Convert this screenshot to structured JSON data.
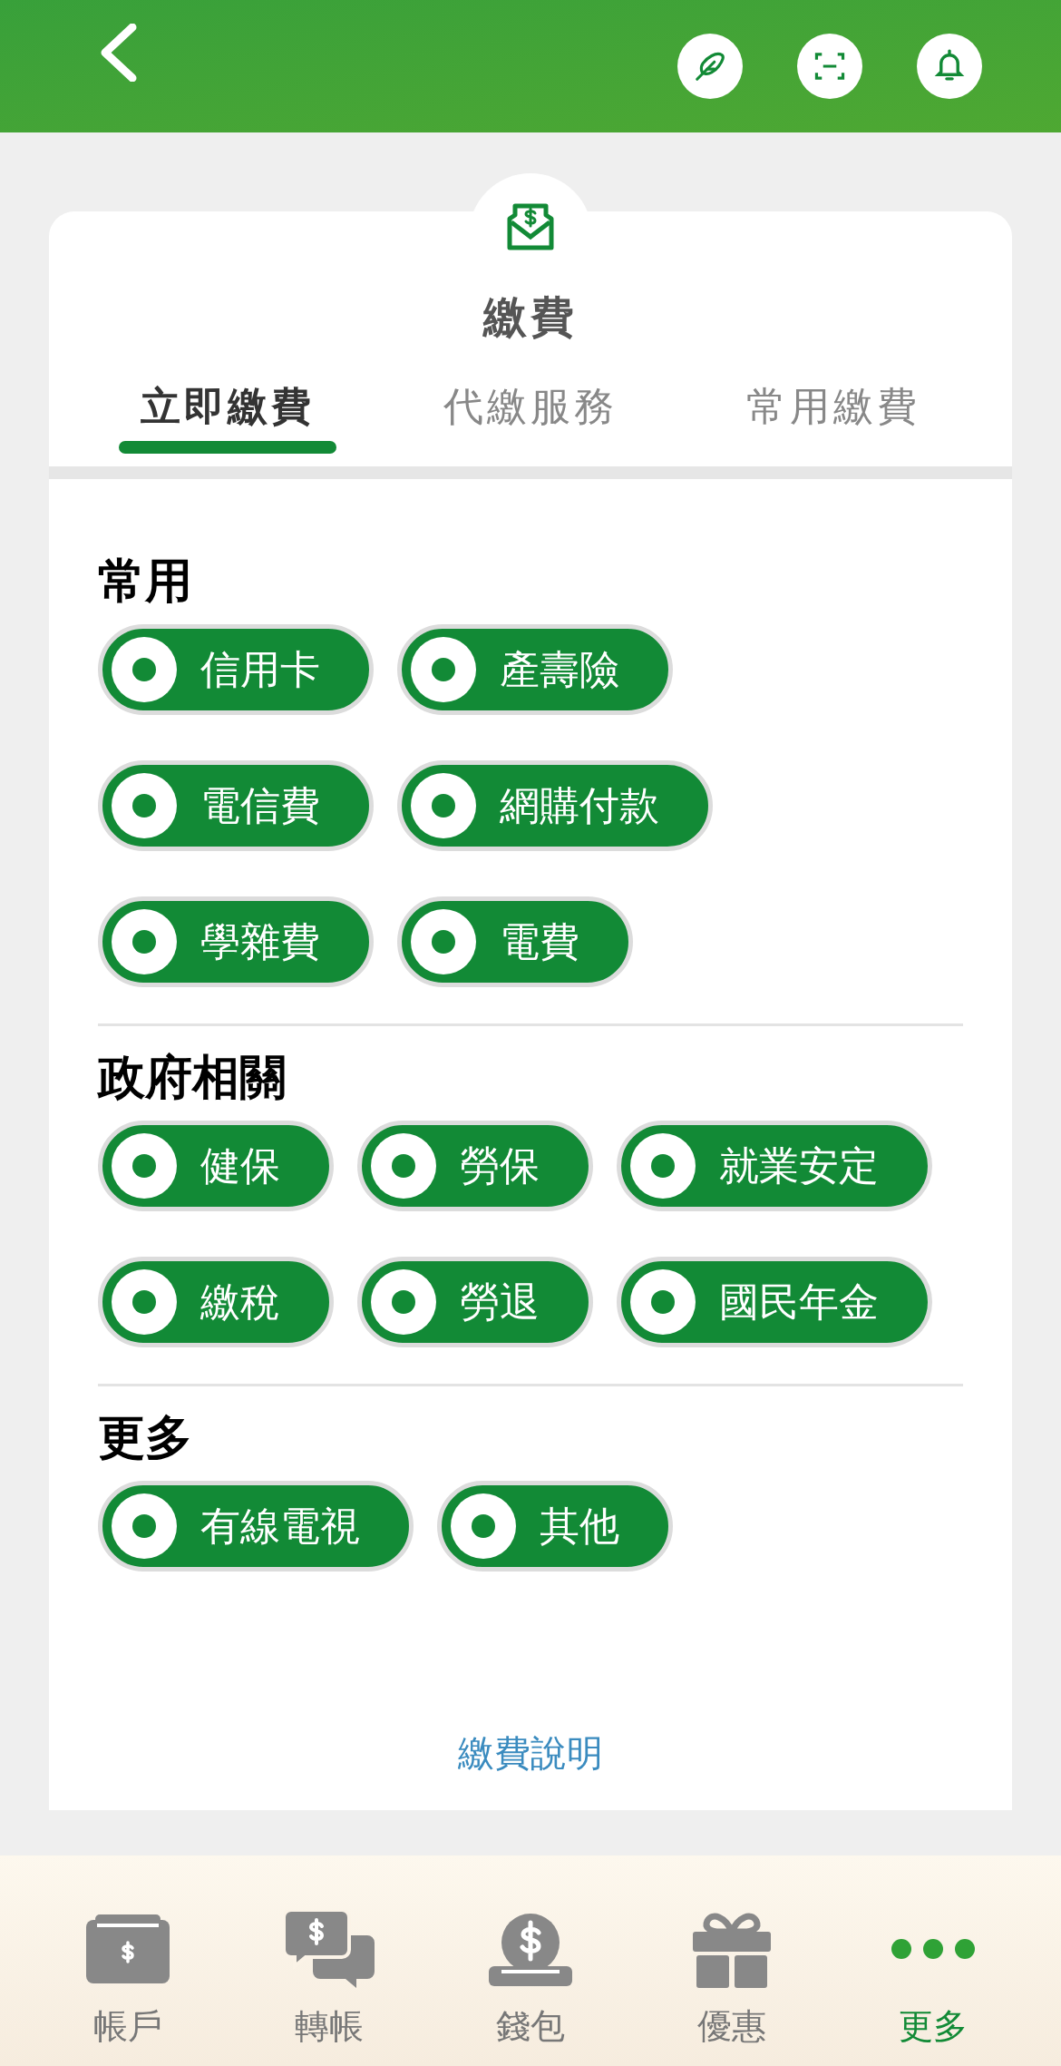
{
  "page": {
    "title": "繳費"
  },
  "tabs": [
    {
      "label": "立即繳費",
      "selected": true
    },
    {
      "label": "代繳服務",
      "selected": false
    },
    {
      "label": "常用繳費",
      "selected": false
    }
  ],
  "sections": [
    {
      "title": "常用",
      "items": [
        "信用卡",
        "產壽險",
        "電信費",
        "網購付款",
        "學雜費",
        "電費"
      ]
    },
    {
      "title": "政府相關",
      "items": [
        "健保",
        "勞保",
        "就業安定",
        "繳稅",
        "勞退",
        "國民年金"
      ]
    },
    {
      "title": "更多",
      "items": [
        "有線電視",
        "其他"
      ]
    }
  ],
  "help_link": "繳費說明",
  "nav": [
    {
      "label": "帳戶",
      "selected": false
    },
    {
      "label": "轉帳",
      "selected": false
    },
    {
      "label": "錢包",
      "selected": false
    },
    {
      "label": "優惠",
      "selected": false
    },
    {
      "label": "更多",
      "selected": true
    }
  ]
}
